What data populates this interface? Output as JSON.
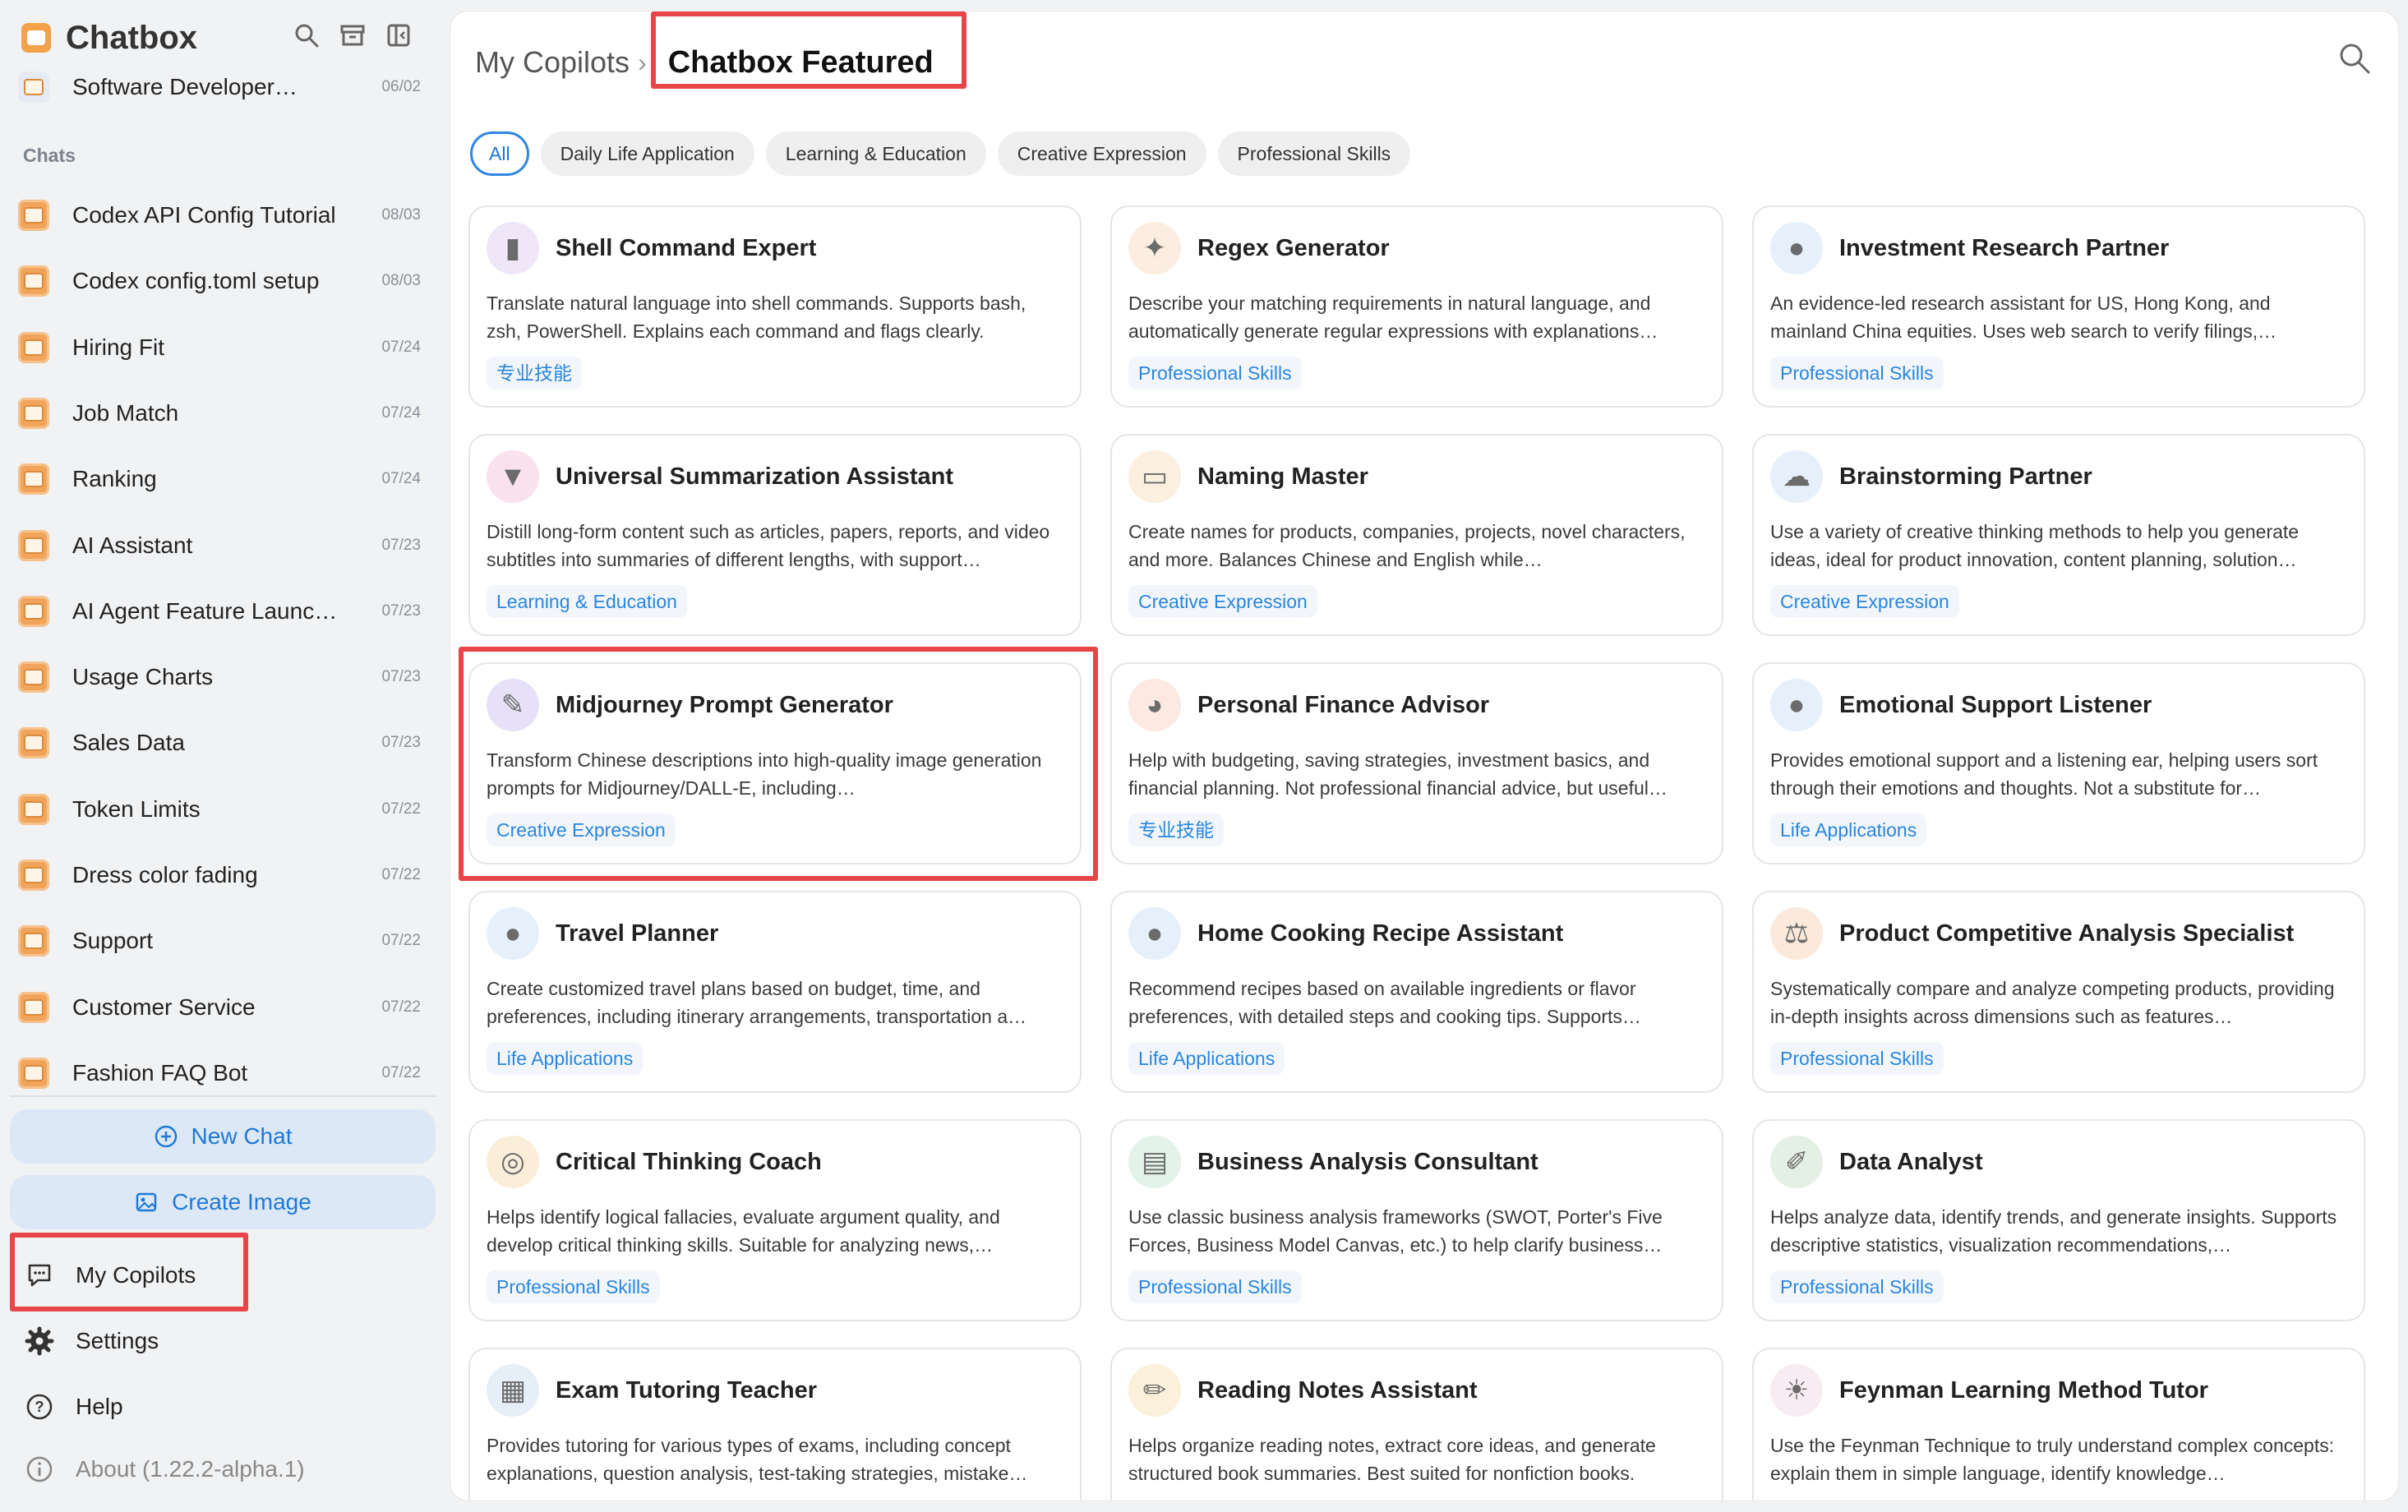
{
  "app": {
    "title": "Chatbox"
  },
  "pinned_chat": {
    "title": "Software Developer…",
    "date": "06/02"
  },
  "sidebar": {
    "section_label": "Chats",
    "chats": [
      {
        "title": "Codex API Config Tutorial",
        "date": "08/03"
      },
      {
        "title": "Codex config.toml setup",
        "date": "08/03"
      },
      {
        "title": "Hiring Fit",
        "date": "07/24"
      },
      {
        "title": "Job Match",
        "date": "07/24"
      },
      {
        "title": "Ranking",
        "date": "07/24"
      },
      {
        "title": "AI Assistant",
        "date": "07/23"
      },
      {
        "title": "AI Agent Feature Launc…",
        "date": "07/23"
      },
      {
        "title": "Usage Charts",
        "date": "07/23"
      },
      {
        "title": "Sales Data",
        "date": "07/23"
      },
      {
        "title": "Token Limits",
        "date": "07/22"
      },
      {
        "title": "Dress color fading",
        "date": "07/22"
      },
      {
        "title": "Support",
        "date": "07/22"
      },
      {
        "title": "Customer Service",
        "date": "07/22"
      },
      {
        "title": "Fashion FAQ Bot",
        "date": "07/22"
      }
    ],
    "new_chat_label": "New Chat",
    "create_image_label": "Create Image",
    "menu": {
      "copilots": "My Copilots",
      "settings": "Settings",
      "help": "Help",
      "about": "About (1.22.2-alpha.1)"
    }
  },
  "main": {
    "breadcrumb_parent": "My Copilots",
    "breadcrumb_sep": "›",
    "breadcrumb_current": "Chatbox Featured",
    "tabs": [
      "All",
      "Daily Life Application",
      "Learning & Education",
      "Creative Expression",
      "Professional Skills"
    ],
    "active_tab": "All",
    "cards": [
      {
        "title": "Shell Command Expert",
        "desc": "Translate natural language into shell commands. Supports bash, zsh, PowerShell. Explains each command and flags clearly.",
        "tag": "专业技能",
        "icon": "terminal-icon",
        "icon_bg": "#efe6f7",
        "glyph": "▮"
      },
      {
        "title": "Regex Generator",
        "desc": "Describe your matching requirements in natural language, and automatically generate regular expressions with explanations…",
        "tag": "Professional Skills",
        "icon": "puzzle-icon",
        "icon_bg": "#fbeee0",
        "glyph": "✦"
      },
      {
        "title": "Investment Research Partner",
        "desc": "An evidence-led research assistant for US, Hong Kong, and mainland China equities. Uses web search to verify filings,…",
        "tag": "Professional Skills",
        "icon": "chat-bubble-icon",
        "icon_bg": "#e6f0fb",
        "glyph": "●"
      },
      {
        "title": "Universal Summarization Assistant",
        "desc": "Distill long-form content such as articles, papers, reports, and video subtitles into summaries of different lengths, with support…",
        "tag": "Learning & Education",
        "icon": "funnel-icon",
        "icon_bg": "#f9e1ee",
        "glyph": "▼"
      },
      {
        "title": "Naming Master",
        "desc": "Create names for products, companies, projects, novel characters, and more. Balances Chinese and English while…",
        "tag": "Creative Expression",
        "icon": "notepad-icon",
        "icon_bg": "#fbefe0",
        "glyph": "▭"
      },
      {
        "title": "Brainstorming Partner",
        "desc": "Use a variety of creative thinking methods to help you generate ideas, ideal for product innovation, content planning, solution…",
        "tag": "Creative Expression",
        "icon": "cloud-icon",
        "icon_bg": "#e5f0fa",
        "glyph": "☁"
      },
      {
        "title": "Midjourney Prompt Generator",
        "desc": "Transform Chinese descriptions into high-quality image generation prompts for Midjourney/DALL-E, including…",
        "tag": "Creative Expression",
        "icon": "magic-wand-icon",
        "icon_bg": "#e7e1f7",
        "glyph": "✎"
      },
      {
        "title": "Personal Finance Advisor",
        "desc": "Help with budgeting, saving strategies, investment basics, and financial planning. Not professional financial advice, but useful…",
        "tag": "专业技能",
        "icon": "piggy-bank-icon",
        "icon_bg": "#fbe9e2",
        "glyph": "◕"
      },
      {
        "title": "Emotional Support Listener",
        "desc": "Provides emotional support and a listening ear, helping users sort through their emotions and thoughts. Not a substitute for…",
        "tag": "Life Applications",
        "icon": "chat-bubble-icon",
        "icon_bg": "#e6f0fb",
        "glyph": "●"
      },
      {
        "title": "Travel Planner",
        "desc": "Create customized travel plans based on budget, time, and preferences, including itinerary arrangements, transportation a…",
        "tag": "Life Applications",
        "icon": "chat-bubble-icon",
        "icon_bg": "#e6f0fb",
        "glyph": "●"
      },
      {
        "title": "Home Cooking Recipe Assistant",
        "desc": "Recommend recipes based on available ingredients or flavor preferences, with detailed steps and cooking tips. Supports…",
        "tag": "Life Applications",
        "icon": "chat-bubble-icon",
        "icon_bg": "#e6f0fb",
        "glyph": "●"
      },
      {
        "title": "Product Competitive Analysis Specialist",
        "desc": "Systematically compare and analyze competing products, providing in-depth insights across dimensions such as features…",
        "tag": "Professional Skills",
        "icon": "scales-icon",
        "icon_bg": "#fbeadb",
        "glyph": "⚖"
      },
      {
        "title": "Critical Thinking Coach",
        "desc": "Helps identify logical fallacies, evaluate argument quality, and develop critical thinking skills. Suitable for analyzing news,…",
        "tag": "Professional Skills",
        "icon": "magnifier-icon",
        "icon_bg": "#fbeed9",
        "glyph": "◎"
      },
      {
        "title": "Business Analysis Consultant",
        "desc": "Use classic business analysis frameworks (SWOT, Porter's Five Forces, Business Model Canvas, etc.) to help clarify business…",
        "tag": "Professional Skills",
        "icon": "chart-icon",
        "icon_bg": "#e3f3ea",
        "glyph": "▤"
      },
      {
        "title": "Data Analyst",
        "desc": "Helps analyze data, identify trends, and generate insights. Supports descriptive statistics, visualization recommendations,…",
        "tag": "Professional Skills",
        "icon": "pencil-cup-icon",
        "icon_bg": "#e4efe6",
        "glyph": "✐"
      },
      {
        "title": "Exam Tutoring Teacher",
        "desc": "Provides tutoring for various types of exams, including concept explanations, question analysis, test-taking strategies, mistake…",
        "tag": "",
        "icon": "book-icon",
        "icon_bg": "#e6eef8",
        "glyph": "▦"
      },
      {
        "title": "Reading Notes Assistant",
        "desc": "Helps organize reading notes, extract core ideas, and generate structured book summaries. Best suited for nonfiction books.",
        "tag": "",
        "icon": "pencil-icon",
        "icon_bg": "#fbf0d9",
        "glyph": "✏"
      },
      {
        "title": "Feynman Learning Method Tutor",
        "desc": "Use the Feynman Technique to truly understand complex concepts: explain them in simple language, identify knowledge…",
        "tag": "",
        "icon": "sunrise-icon",
        "icon_bg": "#f7ecf2",
        "glyph": "☀"
      }
    ]
  },
  "colors": {
    "accent": "#1e79d8",
    "highlight": "#e84549",
    "tag_text": "#2a86de"
  }
}
